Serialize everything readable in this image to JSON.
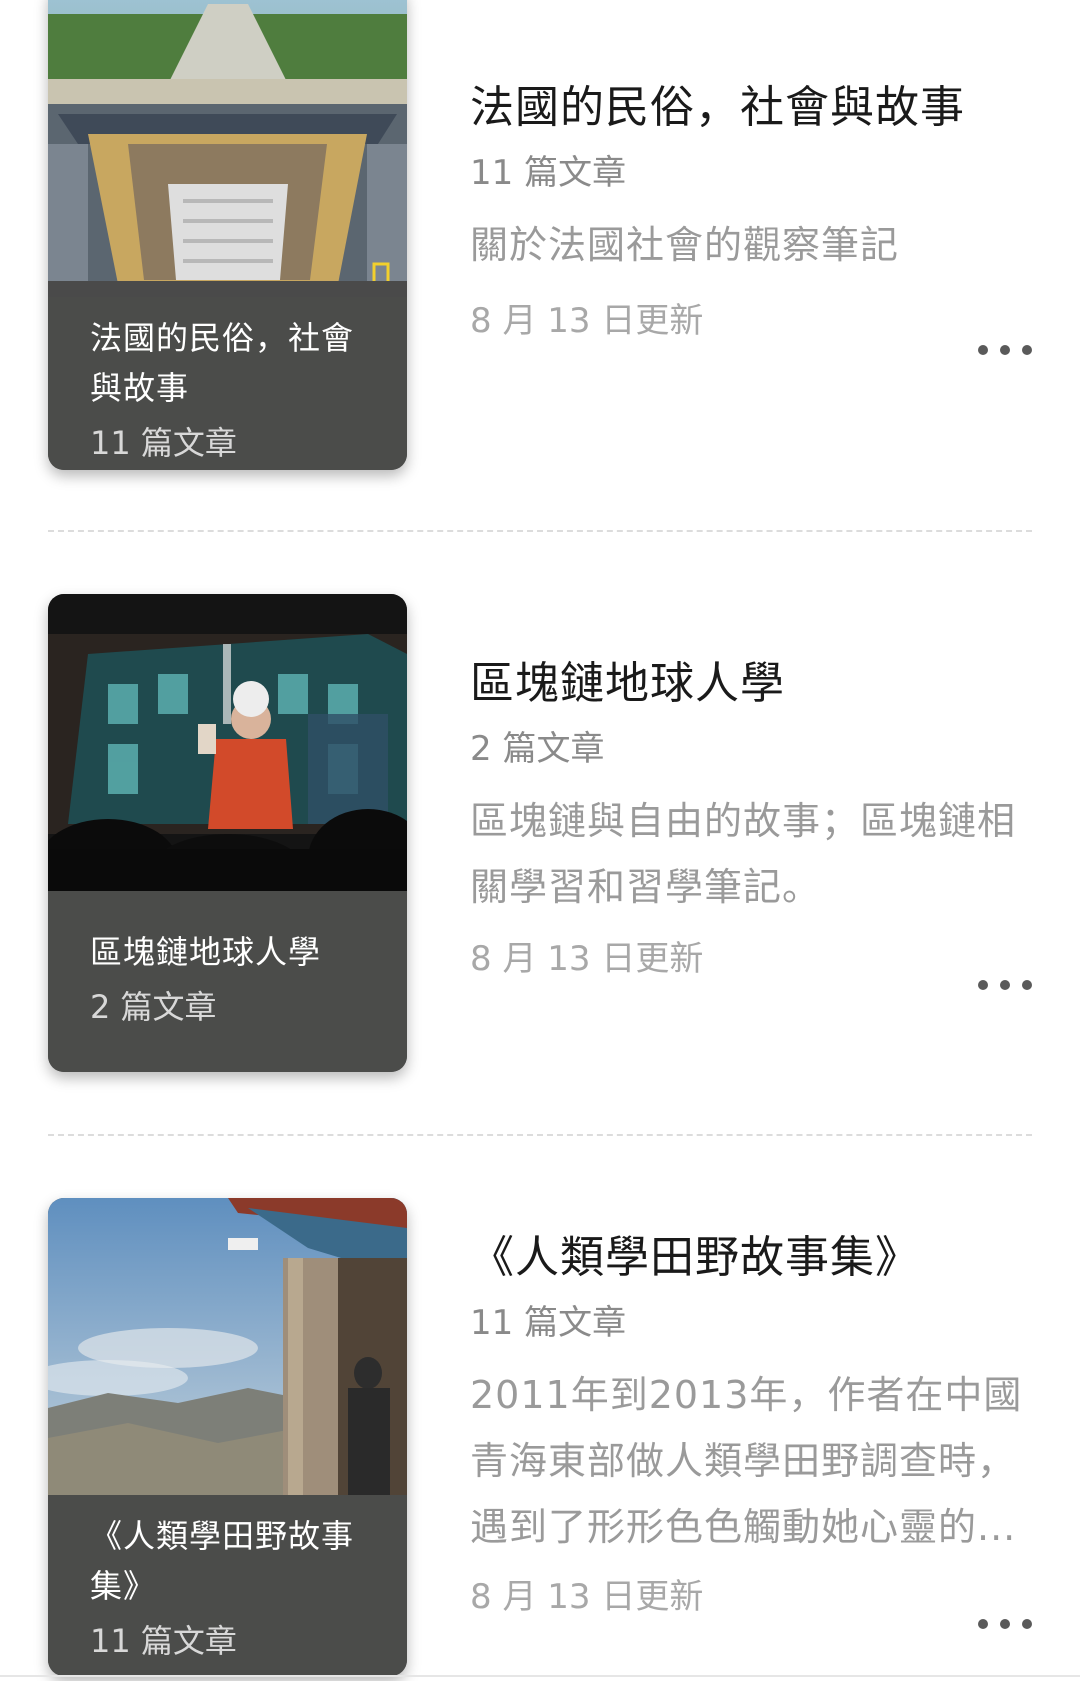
{
  "collections": [
    {
      "title": "法國的民俗，社會與故事",
      "cover_title_line1": "法國的民俗，社會",
      "cover_title_line2": "與故事",
      "count": "11 篇文章",
      "desc_line1": "關於法國社會的觀察筆記",
      "updated": "8 月 13 日更新",
      "more_icon": "more-horizontal-icon"
    },
    {
      "title": "區塊鏈地球人學",
      "cover_title_line1": "區塊鏈地球人學",
      "count": "2 篇文章",
      "desc_line1": "區塊鏈與自由的故事；區塊鏈相",
      "desc_line2": "關學習和習學筆記。",
      "updated": "8 月 13 日更新",
      "more_icon": "more-horizontal-icon"
    },
    {
      "title": "《人類學田野故事集》",
      "cover_title_line1": "《人類學田野故事",
      "cover_title_line2": "集》",
      "count": "11 篇文章",
      "desc_line1": "2011年到2013年，作者在中國",
      "desc_line2": "青海東部做人類學田野調查時，",
      "desc_line3": "遇到了形形色色觸動她心靈的...",
      "updated": "8 月 13 日更新",
      "more_icon": "more-horizontal-icon"
    }
  ]
}
